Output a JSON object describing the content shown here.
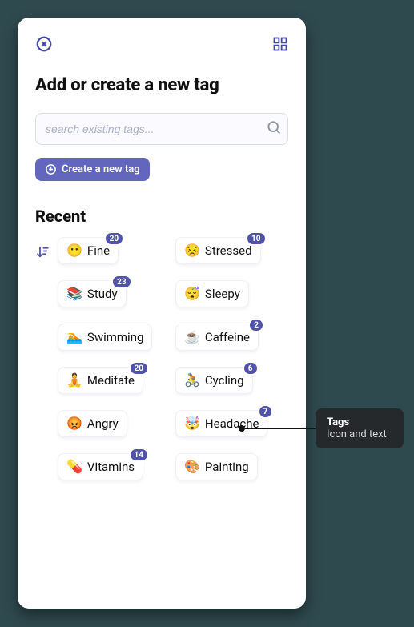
{
  "colors": {
    "accent": "#5153a9",
    "button": "#6266bd"
  },
  "header": {
    "title": "Add or create a new tag"
  },
  "search": {
    "placeholder": "search existing tags..."
  },
  "create": {
    "label": "Create a new tag"
  },
  "section": {
    "recent_title": "Recent"
  },
  "tags": [
    {
      "emoji": "😶",
      "label": "Fine",
      "badge": "20"
    },
    {
      "emoji": "😣",
      "label": "Stressed",
      "badge": "10"
    },
    {
      "emoji": "📚",
      "label": "Study",
      "badge": "23"
    },
    {
      "emoji": "😴",
      "label": "Sleepy",
      "badge": null
    },
    {
      "emoji": "🏊",
      "label": "Swimming",
      "badge": null
    },
    {
      "emoji": "☕",
      "label": "Caffeine",
      "badge": "2"
    },
    {
      "emoji": "🧘",
      "label": "Meditate",
      "badge": "20"
    },
    {
      "emoji": "🚴",
      "label": "Cycling",
      "badge": "6"
    },
    {
      "emoji": "😡",
      "label": "Angry",
      "badge": null
    },
    {
      "emoji": "🤯",
      "label": "Headache",
      "badge": "7"
    },
    {
      "emoji": "💊",
      "label": "Vitamins",
      "badge": "14"
    },
    {
      "emoji": "🎨",
      "label": "Painting",
      "badge": null
    }
  ],
  "annotation": {
    "title": "Tags",
    "subtitle": "Icon and text"
  }
}
